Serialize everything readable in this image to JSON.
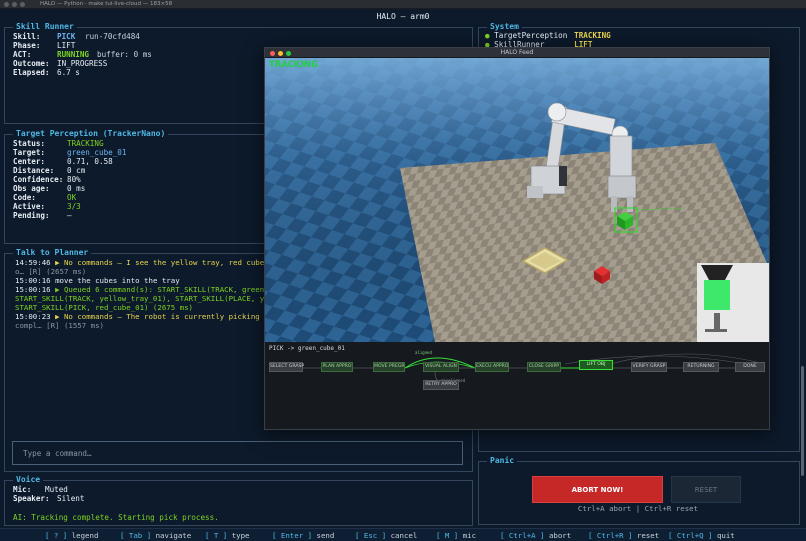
{
  "window": {
    "title": "HALO — Python · make tui-live-cloud — 183×58"
  },
  "app": {
    "title": "HALO  —  arm0"
  },
  "skill_runner": {
    "title": "Skill Runner",
    "skill_label": "Skill:",
    "skill": "PICK",
    "run_id": "run-70cfd484",
    "phase_label": "Phase:",
    "phase": "LIFT",
    "act_label": "ACT:",
    "act": "RUNNING",
    "buffer": "buffer: 0 ms",
    "outcome_label": "Outcome:",
    "outcome": "IN_PROGRESS",
    "elapsed_label": "Elapsed:",
    "elapsed": "6.7 s"
  },
  "target_perception": {
    "title": "Target Perception (TrackerNano)",
    "rows": [
      {
        "label": "Status:",
        "value": "TRACKING",
        "tone": "green"
      },
      {
        "label": "Target:",
        "value": "green_cube_01",
        "tone": "blue"
      },
      {
        "label": "Center:",
        "value": "0.71, 0.58",
        "tone": "white"
      },
      {
        "label": "Distance:",
        "value": "0 cm",
        "tone": "white"
      },
      {
        "label": "Confidence:",
        "value": "80%",
        "tone": "white"
      },
      {
        "label": "Obs age:",
        "value": "0 ms",
        "tone": "white"
      },
      {
        "label": "Code:",
        "value": "OK",
        "tone": "green"
      },
      {
        "label": "Active:",
        "value": "3/3",
        "tone": "green"
      },
      {
        "label": "Pending:",
        "value": "—",
        "tone": "white"
      }
    ]
  },
  "planner": {
    "title": "Talk to Planner",
    "lines": [
      {
        "ts": "14:59:46",
        "text": "▶ No commands — I see the yellow tray, red cube,",
        "tone": "yellow"
      },
      {
        "ts": "",
        "text": "o…  [R]  (2657 ms)",
        "tone": "dim"
      },
      {
        "ts": "15:00:16",
        "text": "move the cubes into the tray",
        "tone": "white"
      },
      {
        "ts": "15:00:16",
        "text": "▶ Queued 6 command(s): START_SKILL(TRACK, green_",
        "tone": "green"
      },
      {
        "ts": "",
        "text": "START_SKILL(TRACK, yellow_tray_01), START_SKILL(PLACE, yel",
        "tone": "green"
      },
      {
        "ts": "",
        "text": "START_SKILL(PICK, red_cube_01)  (2675 ms)",
        "tone": "green"
      },
      {
        "ts": "15:00:23",
        "text": "▶ No commands — The robot is currently picking th",
        "tone": "yellow"
      },
      {
        "ts": "",
        "text": "compl…  [R]  (1557 ms)",
        "tone": "dim"
      }
    ],
    "input_placeholder": "Type a command…"
  },
  "voice": {
    "title": "Voice",
    "mic_label": "Mic:",
    "mic": "Muted",
    "speaker_label": "Speaker:",
    "speaker": "Silent",
    "ai_text": "AI: Tracking complete. Starting pick process."
  },
  "system": {
    "title": "System",
    "rows": [
      {
        "name": "TargetPerception",
        "status": "TRACKING"
      },
      {
        "name": "SkillRunner",
        "status": "LIFT"
      }
    ]
  },
  "feed": {
    "title": "HALO Feed",
    "overlay": "TRACKING",
    "graph_title": "PICK -> green_cube_01",
    "nodes": [
      "SELECT GRASP",
      "PLAN APPRO",
      "MOVE PREGR",
      "VISUAL ALIGN",
      "EXECU APPRO",
      "CLOSE GRIPP",
      "LIFT OBJ",
      "VERIFY GRASP",
      "RETURNING",
      "DONE",
      "RETRY APPRO"
    ],
    "edge_labels": [
      "aligned",
      "misaligned"
    ]
  },
  "panic": {
    "title": "Panic",
    "abort_label": "ABORT NOW!",
    "reset_label": "RESET",
    "hint": "Ctrl+A abort  |  Ctrl+R reset"
  },
  "keybar": [
    {
      "key": "[ ? ]",
      "desc": "legend"
    },
    {
      "key": "[ Tab ]",
      "desc": "navigate"
    },
    {
      "key": "[ T ]",
      "desc": "type"
    },
    {
      "key": "[ Enter ]",
      "desc": "send"
    },
    {
      "key": "[ Esc ]",
      "desc": "cancel"
    },
    {
      "key": "[ M ]",
      "desc": "mic"
    },
    {
      "key": "[ Ctrl+A ]",
      "desc": "abort"
    },
    {
      "key": "[ Ctrl+R ]",
      "desc": "reset"
    },
    {
      "key": "[ Ctrl+Q ]",
      "desc": "quit"
    }
  ],
  "colors": {
    "accent": "#4fb8e6",
    "ok": "#7ed321",
    "warn": "#e8d44d",
    "danger": "#c62828",
    "background": "#0d1a2b"
  }
}
